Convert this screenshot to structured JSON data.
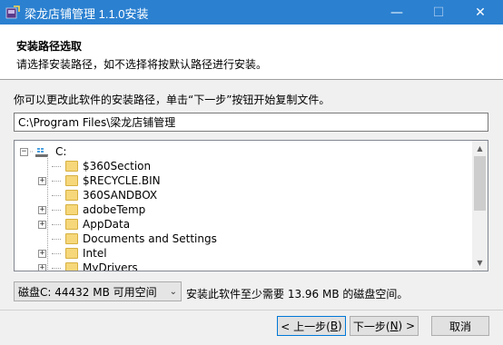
{
  "window": {
    "title": "梁龙店铺管理 1.1.0安装",
    "minimize_glyph": "—",
    "maximize_glyph": "☐",
    "close_glyph": "✕"
  },
  "header": {
    "title": "安装路径选取",
    "subtitle": "请选择安装路径，如不选择将按默认路径进行安装。"
  },
  "main": {
    "instruction": "你可以更改此软件的安装路径，单击“下一步”按钮开始复制文件。",
    "path_value": "C:\\Program Files\\梁龙店铺管理",
    "tree": {
      "root_label": "C:",
      "items": [
        {
          "label": "$360Section",
          "expander": ""
        },
        {
          "label": "$RECYCLE.BIN",
          "expander": "+"
        },
        {
          "label": "360SANDBOX",
          "expander": ""
        },
        {
          "label": "adobeTemp",
          "expander": "+"
        },
        {
          "label": "AppData",
          "expander": "+"
        },
        {
          "label": "Documents and Settings",
          "expander": ""
        },
        {
          "label": "Intel",
          "expander": "+"
        },
        {
          "label": "MyDrivers",
          "expander": "+"
        }
      ]
    },
    "drive_select": "磁盘C:  44432 MB 可用空间",
    "space_required": "安装此软件至少需要 13.96 MB 的磁盘空间。"
  },
  "footer": {
    "prev_label": "< 上一步(",
    "prev_key": "B",
    "prev_end": ")",
    "next_label": "下一步(",
    "next_key": "N",
    "next_end": ") >",
    "cancel_label": "取消"
  },
  "colors": {
    "titlebar": "#2b80d0",
    "content_bg": "#f0f0f0",
    "focus_border": "#0078d7"
  }
}
